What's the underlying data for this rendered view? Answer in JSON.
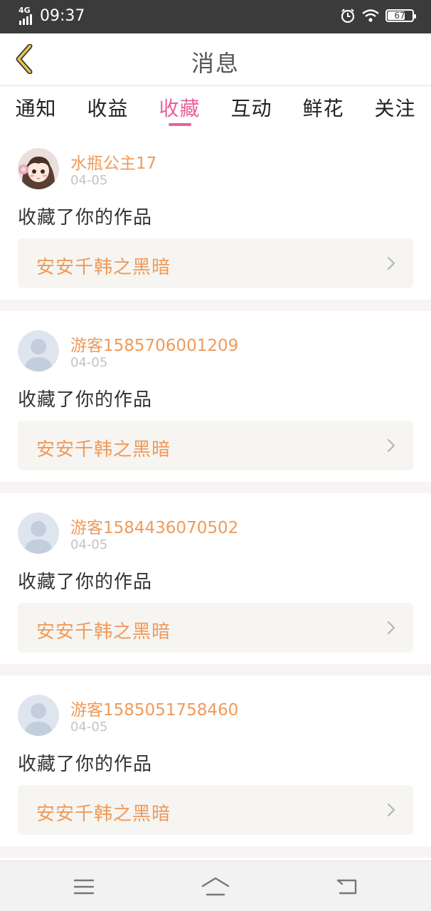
{
  "status_bar": {
    "network": "4G",
    "time": "09:37",
    "battery": "67",
    "battery_level": 0.67,
    "icons": [
      "signal-icon",
      "alarm-icon",
      "wifi-icon",
      "battery-icon"
    ]
  },
  "header": {
    "title": "消息",
    "back_icon": "chevron-left-icon"
  },
  "tabs": [
    {
      "label": "通知"
    },
    {
      "label": "收益"
    },
    {
      "label": "收藏",
      "active": true
    },
    {
      "label": "互动"
    },
    {
      "label": "鲜花"
    },
    {
      "label": "关注"
    }
  ],
  "messages": [
    {
      "user": "水瓶公主17",
      "date": "04-05",
      "action": "收藏了你的作品",
      "work": "安安千韩之黑暗",
      "avatar": "anime-girl-avatar"
    },
    {
      "user": "游客1585706001209",
      "date": "04-05",
      "action": "收藏了你的作品",
      "work": "安安千韩之黑暗",
      "avatar": "default-user-avatar"
    },
    {
      "user": "游客1584436070502",
      "date": "04-05",
      "action": "收藏了你的作品",
      "work": "安安千韩之黑暗",
      "avatar": "default-user-avatar"
    },
    {
      "user": "游客1585051758460",
      "date": "04-05",
      "action": "收藏了你的作品",
      "work": "安安千韩之黑暗",
      "avatar": "default-user-avatar"
    }
  ],
  "system_nav": [
    "menu-icon",
    "home-icon",
    "back-icon"
  ],
  "colors": {
    "accent": "#e8619a",
    "username": "#ef9a5b",
    "back_arrow": "#d9b43c",
    "status_bar": "#3b3b3b"
  }
}
